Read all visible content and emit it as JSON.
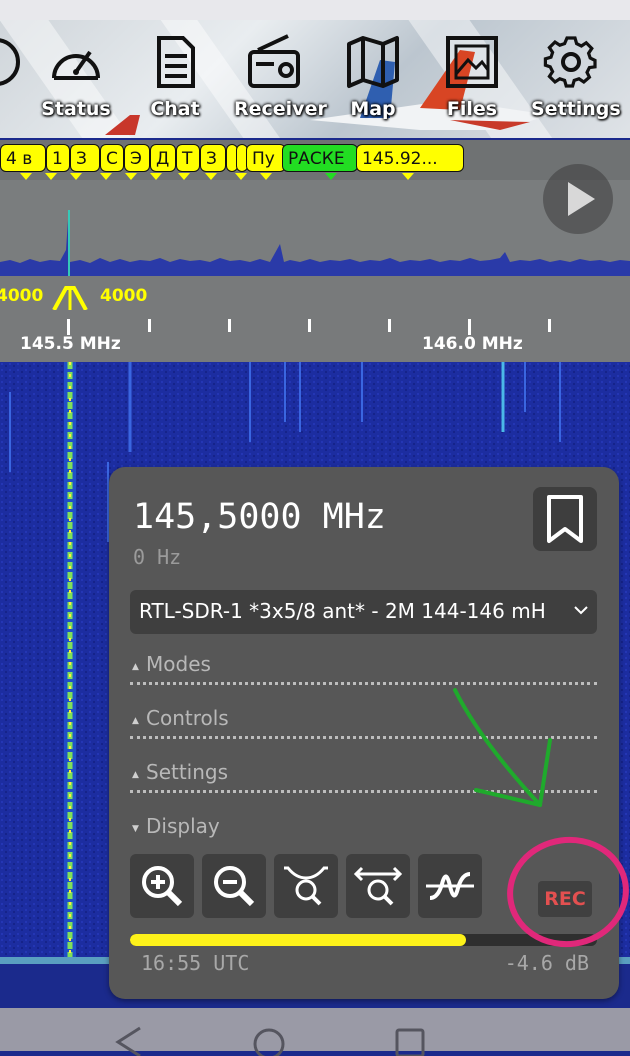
{
  "nav": {
    "items": [
      {
        "label": "",
        "icon": "partial-icon"
      },
      {
        "label": "Status",
        "icon": "gauge-icon"
      },
      {
        "label": "Chat",
        "icon": "document-icon"
      },
      {
        "label": "Receiver",
        "icon": "radio-icon"
      },
      {
        "label": "Map",
        "icon": "map-icon"
      },
      {
        "label": "Files",
        "icon": "image-icon"
      },
      {
        "label": "Settings",
        "icon": "gear-icon"
      }
    ]
  },
  "bookmarks": [
    {
      "label": "4 в",
      "color": "#ffff00"
    },
    {
      "label": "1",
      "color": "#ffff00"
    },
    {
      "label": "З",
      "color": "#ffff00"
    },
    {
      "label": "С",
      "color": "#ffff00"
    },
    {
      "label": "Э",
      "color": "#ffff00"
    },
    {
      "label": "Д",
      "color": "#ffff00"
    },
    {
      "label": "Т",
      "color": "#ffff00"
    },
    {
      "label": "З",
      "color": "#ffff00"
    },
    {
      "label": "Пу",
      "color": "#ffff00"
    },
    {
      "label": "РАСКЕ",
      "color": "#22dd22"
    },
    {
      "label": "145.92...",
      "color": "#ffff00"
    }
  ],
  "scale": {
    "bandwidth_left": "4000",
    "bandwidth_right": "4000",
    "freq_left": "145.5 MHz",
    "freq_right": "146.0 MHz"
  },
  "panel": {
    "frequency": "145,5000 MHz",
    "offset": "0 Hz",
    "profile": "RTL-SDR-1 *3x5/8 ant* - 2M 144-146 mH",
    "sections": [
      {
        "label": "Modes",
        "state": "collapsed"
      },
      {
        "label": "Controls",
        "state": "collapsed"
      },
      {
        "label": "Settings",
        "state": "collapsed"
      },
      {
        "label": "Display",
        "state": "expanded"
      }
    ],
    "tools": [
      "zoom-in-icon",
      "zoom-out-icon",
      "zoom-fit-icon",
      "zoom-center-icon",
      "spectrum-toggle-icon"
    ],
    "rec_label": "REC",
    "meter_level": 0.72,
    "clock": "16:55 UTC",
    "level": "-4.6 dB"
  },
  "colors": {
    "accent_yellow": "#ffff00",
    "accent_green": "#22dd22",
    "panel_bg": "#575757",
    "waterfall_bg": "#1a2b9a",
    "annotation_pink": "#e0287a",
    "annotation_green": "#1faa2c"
  }
}
